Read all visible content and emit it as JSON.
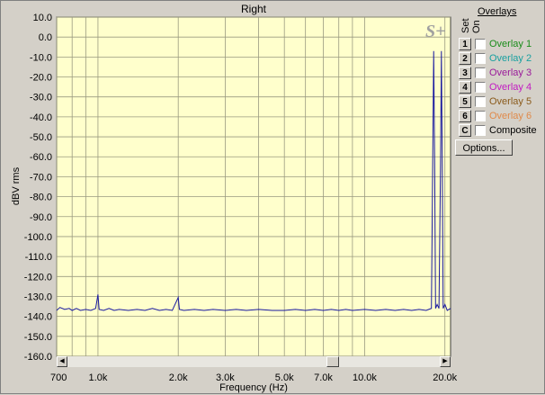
{
  "chart_data": {
    "type": "line",
    "title": "Right",
    "xlabel": "Frequency (Hz)",
    "ylabel": "dBV rms",
    "x_scale": "log",
    "xlim": [
      700,
      21000
    ],
    "ylim": [
      -160,
      10
    ],
    "grid": true,
    "yticks": [
      10,
      0,
      -10,
      -20,
      -30,
      -40,
      -50,
      -60,
      -70,
      -80,
      -90,
      -100,
      -110,
      -120,
      -130,
      -140,
      -150,
      -160
    ],
    "ytick_labels": [
      "10.0",
      "0.0",
      "-10.0",
      "-20.0",
      "-30.0",
      "-40.0",
      "-50.0",
      "-60.0",
      "-70.0",
      "-80.0",
      "-90.0",
      "-100.0",
      "-110.0",
      "-120.0",
      "-130.0",
      "-140.0",
      "-150.0",
      "-160.0"
    ],
    "xticks": [
      700,
      1000,
      2000,
      3000,
      5000,
      7000,
      10000,
      20000
    ],
    "xtick_labels": [
      "700",
      "1.0k",
      "2.0k",
      "3.0k",
      "5.0k",
      "7.0k",
      "10.0k",
      "20.0k"
    ],
    "x_minor_grid": [
      800,
      900,
      4000,
      6000,
      8000,
      9000
    ],
    "series": [
      {
        "color": "#1a1aa0",
        "points": [
          [
            700,
            -137
          ],
          [
            720,
            -135.5
          ],
          [
            750,
            -136.5
          ],
          [
            780,
            -136
          ],
          [
            800,
            -137
          ],
          [
            830,
            -136
          ],
          [
            860,
            -137
          ],
          [
            900,
            -136.5
          ],
          [
            940,
            -137
          ],
          [
            980,
            -136
          ],
          [
            1000,
            -129
          ],
          [
            1010,
            -136.5
          ],
          [
            1050,
            -137
          ],
          [
            1100,
            -136
          ],
          [
            1150,
            -137
          ],
          [
            1200,
            -136.5
          ],
          [
            1300,
            -137
          ],
          [
            1400,
            -136.5
          ],
          [
            1500,
            -137
          ],
          [
            1600,
            -136
          ],
          [
            1700,
            -137
          ],
          [
            1800,
            -136.5
          ],
          [
            1900,
            -137
          ],
          [
            2000,
            -130.5
          ],
          [
            2020,
            -136.5
          ],
          [
            2100,
            -137
          ],
          [
            2300,
            -136.5
          ],
          [
            2500,
            -137
          ],
          [
            2700,
            -136.5
          ],
          [
            3000,
            -137
          ],
          [
            3300,
            -136.5
          ],
          [
            3600,
            -137
          ],
          [
            4000,
            -136.5
          ],
          [
            4500,
            -137
          ],
          [
            5000,
            -137
          ],
          [
            5500,
            -136.5
          ],
          [
            6000,
            -137
          ],
          [
            6500,
            -136.5
          ],
          [
            7000,
            -137
          ],
          [
            7500,
            -136.5
          ],
          [
            8000,
            -137
          ],
          [
            8500,
            -136.5
          ],
          [
            9000,
            -137
          ],
          [
            10000,
            -136.5
          ],
          [
            11000,
            -137
          ],
          [
            12000,
            -136.5
          ],
          [
            13000,
            -137
          ],
          [
            14000,
            -136.5
          ],
          [
            15000,
            -137
          ],
          [
            16000,
            -136.5
          ],
          [
            17000,
            -137
          ],
          [
            17800,
            -136
          ],
          [
            18000,
            -62
          ],
          [
            18150,
            -7
          ],
          [
            18300,
            -62
          ],
          [
            18450,
            -136
          ],
          [
            18700,
            -134
          ],
          [
            19000,
            -136
          ],
          [
            19250,
            -66
          ],
          [
            19400,
            -7
          ],
          [
            19550,
            -66
          ],
          [
            19700,
            -136
          ],
          [
            20000,
            -134
          ],
          [
            20400,
            -137
          ],
          [
            21000,
            -136
          ]
        ]
      }
    ]
  },
  "logo_text": "S+",
  "overlays": {
    "title": "Overlays",
    "col_set": "Set",
    "col_on": "On",
    "items": [
      {
        "btn": "1",
        "label": "Overlay 1",
        "color": "#1a8c1a"
      },
      {
        "btn": "2",
        "label": "Overlay 2",
        "color": "#1aa0a0"
      },
      {
        "btn": "3",
        "label": "Overlay 3",
        "color": "#9a1a9a"
      },
      {
        "btn": "4",
        "label": "Overlay 4",
        "color": "#c21ac2"
      },
      {
        "btn": "5",
        "label": "Overlay 5",
        "color": "#8a5a1a"
      },
      {
        "btn": "6",
        "label": "Overlay 6",
        "color": "#e08a4a"
      },
      {
        "btn": "C",
        "label": "Composite",
        "color": "#000000"
      }
    ],
    "options_label": "Options..."
  },
  "scrollbar": {
    "left_icon": "arrow-left-icon",
    "right_icon": "arrow-right-icon"
  }
}
